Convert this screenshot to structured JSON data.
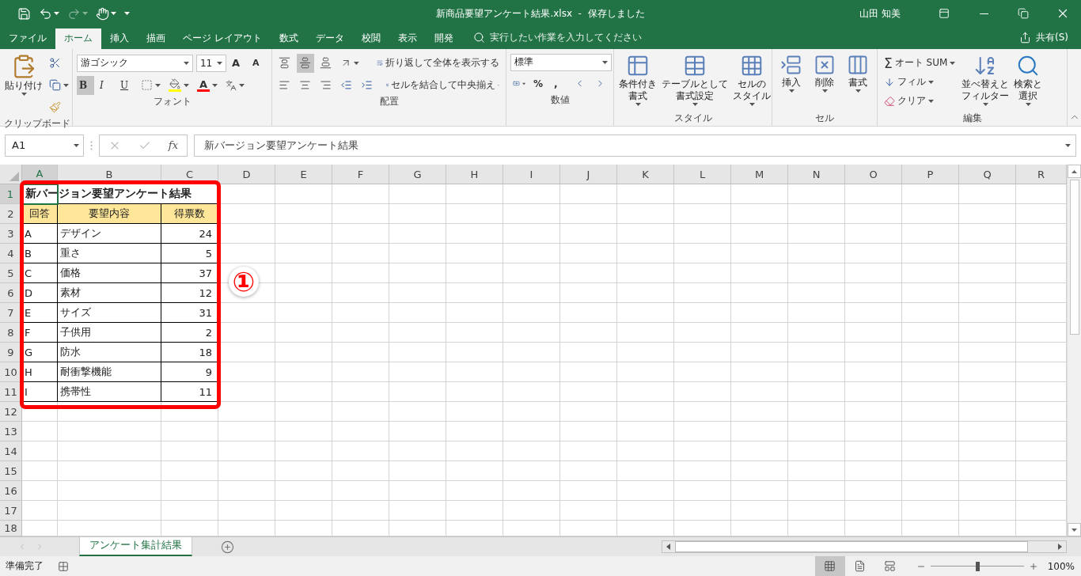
{
  "title_bar": {
    "redo_disabled": true,
    "title": "新商品要望アンケート結果.xlsx  -  保存しました",
    "user": "山田 知美"
  },
  "menu_tabs": [
    {
      "label": "ファイル",
      "selected": false
    },
    {
      "label": "ホーム",
      "selected": true
    },
    {
      "label": "挿入",
      "selected": false
    },
    {
      "label": "描画",
      "selected": false
    },
    {
      "label": "ページ レイアウト",
      "selected": false
    },
    {
      "label": "数式",
      "selected": false
    },
    {
      "label": "データ",
      "selected": false
    },
    {
      "label": "校閲",
      "selected": false
    },
    {
      "label": "表示",
      "selected": false
    },
    {
      "label": "開発",
      "selected": false
    }
  ],
  "tell_me": {
    "placeholder": "実行したい作業を入力してください"
  },
  "share": "共有(S)",
  "ribbon": {
    "clipboard": {
      "paste": "貼り付け",
      "label": "クリップボード"
    },
    "font": {
      "name": "游ゴシック",
      "size": "11",
      "grow": "A",
      "shrink": "A",
      "styles": [
        {
          "label": "B",
          "selected": true
        },
        {
          "label": "I",
          "selected": false
        },
        {
          "label": "U",
          "selected": false
        }
      ],
      "color_letter": "A",
      "label": "フォント"
    },
    "alignment": {
      "vertical": [
        {
          "selected": false
        },
        {
          "selected": true
        },
        {
          "selected": false
        }
      ],
      "wrap": "折り返して全体を表示する",
      "merge": "セルを結合して中央揃え",
      "label": "配置"
    },
    "number": {
      "format": "標準",
      "symbols": [
        "%",
        ","
      ],
      "label": "数値"
    },
    "styles": {
      "buttons": [
        {
          "lines": [
            "条件付き",
            "書式"
          ]
        },
        {
          "lines": [
            "テーブルとして",
            "書式設定"
          ]
        },
        {
          "lines": [
            "セルの",
            "スタイル"
          ]
        }
      ],
      "label": "スタイル"
    },
    "cells": {
      "buttons": [
        "挿入",
        "削除",
        "書式"
      ],
      "label": "セル"
    },
    "editing": {
      "sigma": "Σ",
      "autosum": "オート SUM",
      "fill": "フィル",
      "clear": "クリア",
      "sort": [
        "並べ替えと",
        "フィルター"
      ],
      "find": [
        "検索と",
        "選択"
      ],
      "label": "編集"
    }
  },
  "formula_bar": {
    "name_box": "A1",
    "fx": "fx",
    "value": "新バージョン要望アンケート結果"
  },
  "sheet": {
    "columns": [
      {
        "label": "A",
        "selected": true
      },
      {
        "label": "B",
        "selected": false
      },
      {
        "label": "C",
        "selected": false
      },
      {
        "label": "D",
        "selected": false
      },
      {
        "label": "E",
        "selected": false
      },
      {
        "label": "F",
        "selected": false
      },
      {
        "label": "G",
        "selected": false
      },
      {
        "label": "H",
        "selected": false
      },
      {
        "label": "I",
        "selected": false
      },
      {
        "label": "J",
        "selected": false
      },
      {
        "label": "K",
        "selected": false
      },
      {
        "label": "L",
        "selected": false
      },
      {
        "label": "M",
        "selected": false
      },
      {
        "label": "N",
        "selected": false
      },
      {
        "label": "O",
        "selected": false
      },
      {
        "label": "P",
        "selected": false
      },
      {
        "label": "Q",
        "selected": false
      },
      {
        "label": "R",
        "selected": false
      }
    ],
    "rows": [
      {
        "label": "1",
        "selected": true
      },
      {
        "label": "2",
        "selected": false
      },
      {
        "label": "3",
        "selected": false
      },
      {
        "label": "4",
        "selected": false
      },
      {
        "label": "5",
        "selected": false
      },
      {
        "label": "6",
        "selected": false
      },
      {
        "label": "7",
        "selected": false
      },
      {
        "label": "8",
        "selected": false
      },
      {
        "label": "9",
        "selected": false
      },
      {
        "label": "10",
        "selected": false
      },
      {
        "label": "11",
        "selected": false
      },
      {
        "label": "12",
        "selected": false
      },
      {
        "label": "13",
        "selected": false
      },
      {
        "label": "14",
        "selected": false
      },
      {
        "label": "15",
        "selected": false
      },
      {
        "label": "16",
        "selected": false
      },
      {
        "label": "17",
        "selected": false
      },
      {
        "label": "18",
        "selected": false
      }
    ],
    "title": "新バージョン要望アンケート結果",
    "header": [
      "回答",
      "要望内容",
      "得票数"
    ],
    "records": [
      [
        "A",
        "デザイン",
        "24"
      ],
      [
        "B",
        "重さ",
        "5"
      ],
      [
        "C",
        "価格",
        "37"
      ],
      [
        "D",
        "素材",
        "12"
      ],
      [
        "E",
        "サイズ",
        "31"
      ],
      [
        "F",
        "子供用",
        "2"
      ],
      [
        "G",
        "防水",
        "18"
      ],
      [
        "H",
        "耐衝撃機能",
        "9"
      ],
      [
        "I",
        "携帯性",
        "11"
      ]
    ],
    "callout": "①"
  },
  "sheet_tabs": [
    {
      "label": "アンケート集計結果",
      "selected": true
    }
  ],
  "status_bar": {
    "status": "準備完了",
    "views": [
      {
        "selected": true
      },
      {
        "selected": false
      },
      {
        "selected": false
      }
    ],
    "zoom": {
      "level": 0.5
    },
    "zoom_text": "100%"
  }
}
